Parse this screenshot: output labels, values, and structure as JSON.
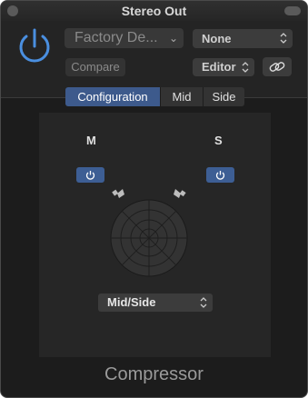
{
  "window": {
    "title": "Stereo Out"
  },
  "header": {
    "preset": "Factory De...",
    "side_chain": "None",
    "compare": "Compare",
    "view": "Editor"
  },
  "tabs": [
    {
      "label": "Configuration",
      "active": true
    },
    {
      "label": "Mid",
      "active": false
    },
    {
      "label": "Side",
      "active": false
    }
  ],
  "configuration": {
    "mid_label": "M",
    "side_label": "S",
    "mode": "Mid/Side"
  },
  "plugin_name": "Compressor",
  "colors": {
    "accent": "#3d5e94",
    "background": "#1c1c1c",
    "power_blue": "#4a8fe0"
  }
}
